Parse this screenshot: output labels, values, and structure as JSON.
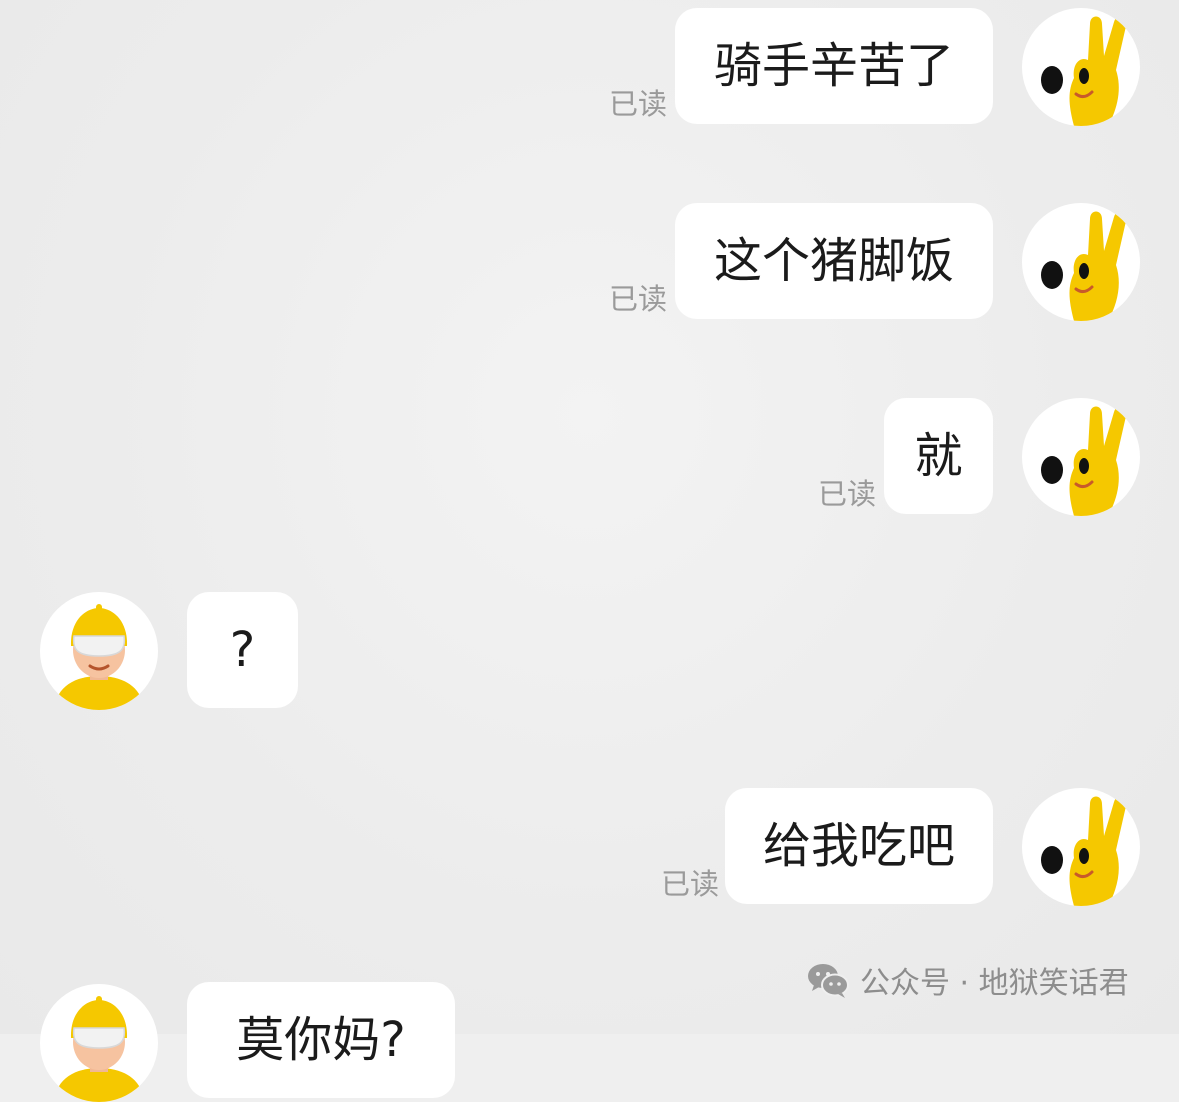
{
  "messages": [
    {
      "side": "right",
      "text": "骑手辛苦了",
      "status": "已读"
    },
    {
      "side": "right",
      "text": "这个猪脚饭",
      "status": "已读"
    },
    {
      "side": "right",
      "text": "就",
      "status": "已读"
    },
    {
      "side": "left",
      "text": "?"
    },
    {
      "side": "right",
      "text": "给我吃吧",
      "status": "已读"
    },
    {
      "side": "left",
      "text": "莫你妈?"
    }
  ],
  "watermark": {
    "icon": "wechat-icon",
    "text": "公众号 · 地狱笑话君"
  },
  "colors": {
    "background": "#efefef",
    "bubble": "#ffffff",
    "read_status": "#9a9a9a",
    "mascot_yellow": "#f5c800"
  }
}
